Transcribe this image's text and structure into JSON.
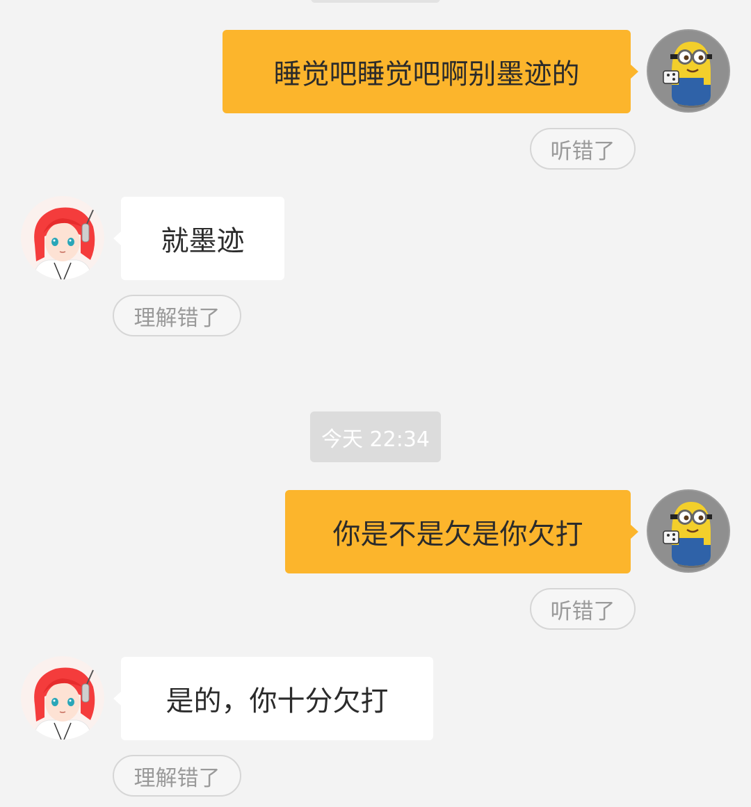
{
  "conversation": {
    "timestamp": "今天 22:34",
    "messages": [
      {
        "sender": "user",
        "text": "睡觉吧睡觉吧啊别墨迹的",
        "feedback_label": "听错了"
      },
      {
        "sender": "assistant",
        "text": "就墨迹",
        "feedback_label": "理解错了"
      },
      {
        "sender": "user",
        "text": "你是不是欠是你欠打",
        "feedback_label": "听错了"
      },
      {
        "sender": "assistant",
        "text": "是的，你十分欠打",
        "feedback_label": "理解错了"
      }
    ]
  },
  "colors": {
    "background": "#f3f3f3",
    "user_bubble": "#fcb52c",
    "assistant_bubble": "#ffffff",
    "feedback_text": "#9a9a9a",
    "timestamp_bg": "#dcdcdc"
  },
  "icons": {
    "user_avatar": "minion-avatar-icon",
    "assistant_avatar": "anime-girl-avatar-icon"
  }
}
